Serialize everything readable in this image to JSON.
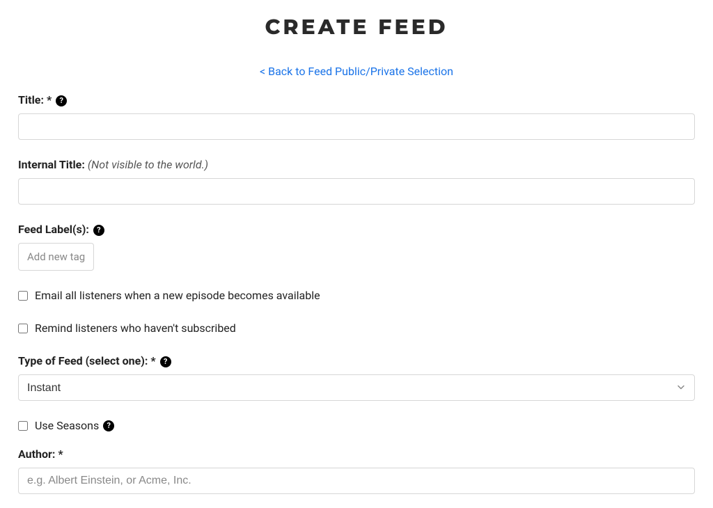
{
  "page": {
    "title": "CREATE FEED",
    "back_link": "< Back to Feed Public/Private Selection"
  },
  "fields": {
    "title": {
      "label": "Title:",
      "required": "*"
    },
    "internal_title": {
      "label": "Internal Title:",
      "subtext": "(Not visible to the world.)"
    },
    "feed_labels": {
      "label": "Feed Label(s):",
      "placeholder": "Add new tag"
    },
    "email_listeners": {
      "label": "Email all listeners when a new episode becomes available"
    },
    "remind_listeners": {
      "label": "Remind listeners who haven't subscribed"
    },
    "feed_type": {
      "label": "Type of Feed (select one):",
      "required": "*",
      "selected": "Instant"
    },
    "use_seasons": {
      "label": "Use Seasons"
    },
    "author": {
      "label": "Author:",
      "required": "*",
      "placeholder": "e.g. Albert Einstein, or Acme, Inc."
    }
  }
}
